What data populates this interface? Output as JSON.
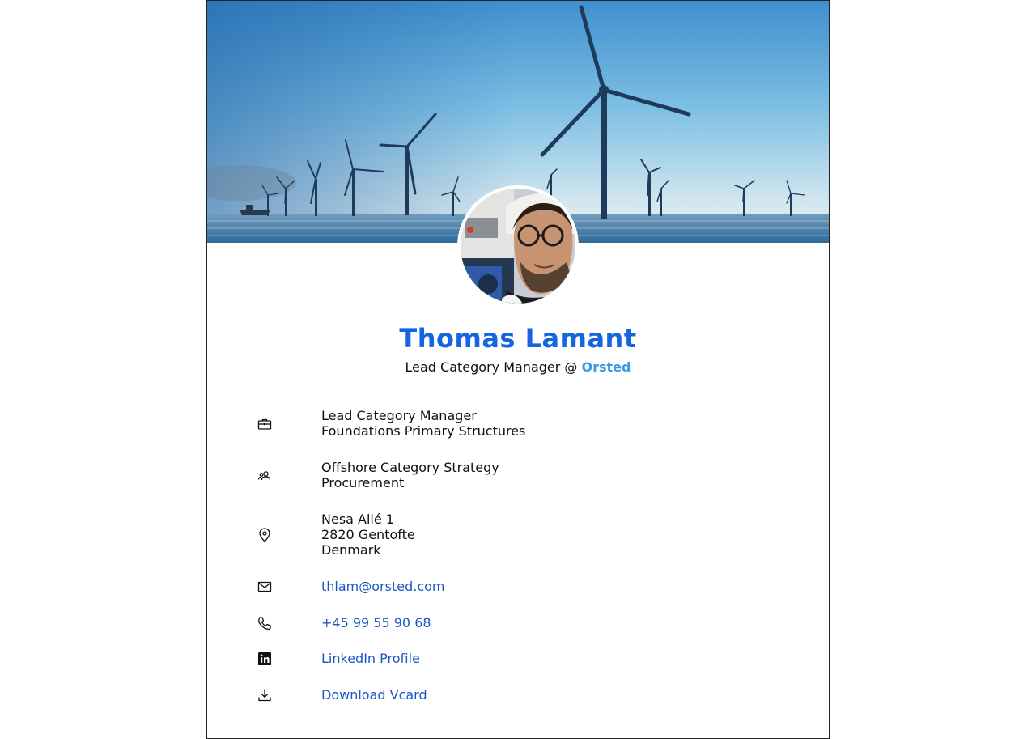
{
  "profile": {
    "name": "Thomas Lamant",
    "title_prefix": "Lead Category Manager @ ",
    "company": "Orsted"
  },
  "details": {
    "role": {
      "icon": "briefcase-icon",
      "lines": [
        "Lead Category Manager",
        "Foundations Primary Structures"
      ]
    },
    "team": {
      "icon": "users-icon",
      "lines": [
        "Offshore Category Strategy",
        "Procurement"
      ]
    },
    "address": {
      "icon": "map-pin-icon",
      "lines": [
        "Nesa Allé 1",
        "2820 Gentofte",
        "Denmark"
      ]
    },
    "email": {
      "icon": "envelope-icon",
      "label": "thlam@orsted.com"
    },
    "phone": {
      "icon": "phone-icon",
      "label": "+45 99 55 90 68"
    },
    "linkedin": {
      "icon": "linkedin-icon",
      "label": "LinkedIn Profile"
    },
    "vcard": {
      "icon": "download-icon",
      "label": "Download Vcard"
    }
  },
  "colors": {
    "name": "#1565e0",
    "company": "#3b9be0",
    "link": "#1a56c4"
  }
}
